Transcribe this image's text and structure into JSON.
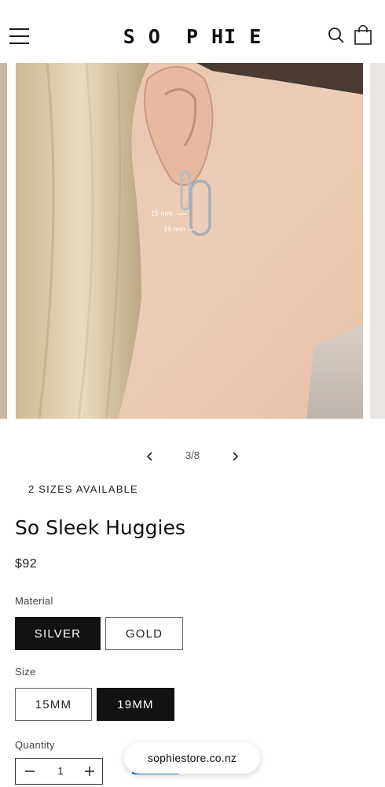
{
  "header": {
    "logo_text": "S O  P HI E",
    "menu_icon": "hamburger-menu-icon",
    "search_icon": "search-icon",
    "cart_icon": "shopping-bag-icon"
  },
  "gallery": {
    "label_15mm": "15 mm",
    "label_19mm": "19 mm",
    "counter": "3/8",
    "prev_icon": "chevron-left-icon",
    "next_icon": "chevron-right-icon"
  },
  "product": {
    "badge": "2 SIZES AVAILABLE",
    "title": "So Sleek Huggies",
    "price": "$92"
  },
  "material": {
    "label": "Material",
    "options": [
      "SILVER",
      "GOLD"
    ],
    "selected": "SILVER"
  },
  "size": {
    "label": "Size",
    "options": [
      "15MM",
      "19MM"
    ],
    "selected": "19MM"
  },
  "quantity": {
    "label": "Quantity",
    "value": "1",
    "minus_icon": "minus-icon",
    "plus_icon": "plus-icon"
  },
  "browser": {
    "domain": "sophiestore.co.nz"
  },
  "colors": {
    "selected_bg": "#121212",
    "accent_blue": "#2f7fe6"
  }
}
